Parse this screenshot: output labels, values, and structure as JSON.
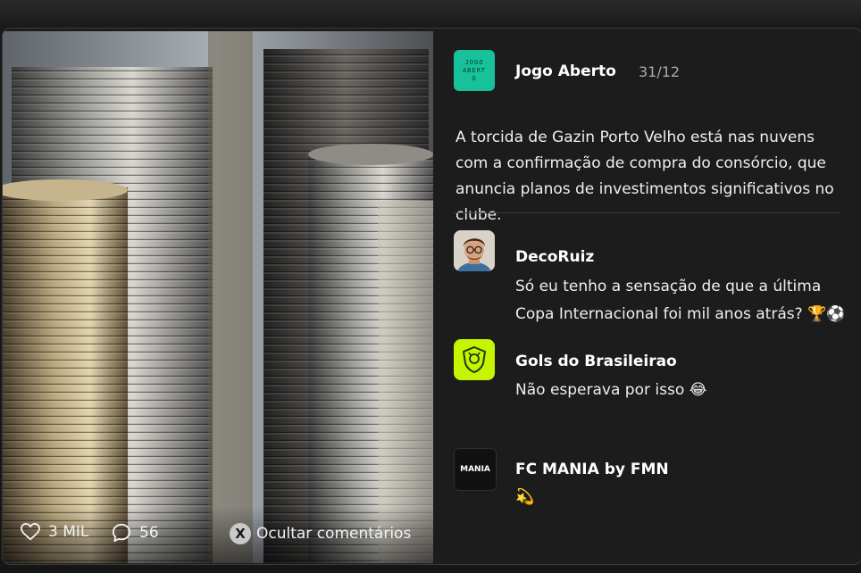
{
  "post": {
    "author": "Jogo Aberto",
    "date": "31/12",
    "avatar_text": "JOGO ABERTO",
    "text": "A torcida de Gazin Porto Velho está nas nuvens com a confirmação de compra do consórcio, que anuncia planos de investimentos significativos no clube."
  },
  "stats": {
    "likes": "3 MIL",
    "comments": "56",
    "hide_label": "Ocultar comentários",
    "hide_icon": "X"
  },
  "comments": [
    {
      "author": "DecoRuiz",
      "text": "Só eu tenho a sensação de que a última Copa Internacional foi mil anos atrás? 🏆⚽"
    },
    {
      "author": "Gols do Brasileirao",
      "text": "Não esperava por isso 😂"
    },
    {
      "author": "FC MANIA by FMN",
      "avatar_text": "MANIA",
      "text": "💫"
    }
  ],
  "icons": {
    "like": "heart-icon",
    "comment": "comment-bubble-icon",
    "hide": "close-circle-icon"
  },
  "colors": {
    "background": "#1c1c1c",
    "jogo_aberto_brand": "#17c29a",
    "gols_brand": "#c6f500"
  }
}
